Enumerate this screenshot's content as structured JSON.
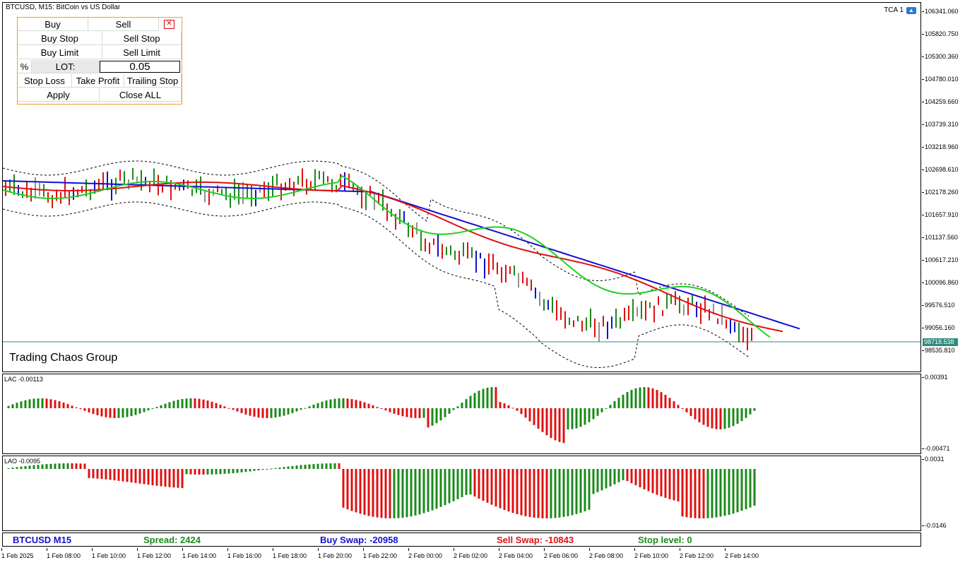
{
  "chart": {
    "title": "BTCUSD, M15:  BitCoin vs US Dollar",
    "tca_label": "TCA 1",
    "group_label": "Trading Chaos Group",
    "current_price": "98718.538",
    "price_ticks": [
      "106341.060",
      "105820.750",
      "105300.360",
      "104780.010",
      "104259.660",
      "103739.310",
      "103218.960",
      "102698.610",
      "102178.260",
      "101657.910",
      "101137.560",
      "100617.210",
      "100096.860",
      "99576.510",
      "99056.160",
      "98535.810"
    ],
    "colors": {
      "bull": "#1a8a1a",
      "bear": "#e01010",
      "neutral": "#909090",
      "blue_ma": "#1010d0",
      "red_ma": "#e01010",
      "green_ma": "#20d020",
      "bands": "#000000",
      "price_line": "#2e8b7a"
    }
  },
  "trade_panel": {
    "buy": "Buy",
    "sell": "Sell",
    "close_icon": "close-icon",
    "buy_stop": "Buy Stop",
    "sell_stop": "Sell Stop",
    "buy_limit": "Buy Limit",
    "sell_limit": "Sell Limit",
    "percent": "%",
    "lot_label": "LOT:",
    "lot_value": "0.05",
    "stop_loss": "Stop Loss",
    "take_profit": "Take Profit",
    "trailing_stop": "Trailing Stop",
    "apply": "Apply",
    "close_all": "Close ALL"
  },
  "lac": {
    "label": "LAC -0.00113",
    "axis_top": "0.00391",
    "axis_bottom": "-0.00471"
  },
  "lao": {
    "label": "LAO -0.0095",
    "axis_top": "0.0031",
    "axis_bottom": "-0.0146"
  },
  "status": {
    "symbol": "BTCUSD M15",
    "spread": "Spread: 2424",
    "buy_swap": "Buy Swap: -20958",
    "sell_swap": "Sell Swap: -10843",
    "stop_level": "Stop level: 0"
  },
  "time_axis": [
    "1 Feb 2025",
    "1 Feb 08:00",
    "1 Feb 10:00",
    "1 Feb 12:00",
    "1 Feb 14:00",
    "1 Feb 16:00",
    "1 Feb 18:00",
    "1 Feb 20:00",
    "1 Feb 22:00",
    "2 Feb 00:00",
    "2 Feb 02:00",
    "2 Feb 04:00",
    "2 Feb 06:00",
    "2 Feb 08:00",
    "2 Feb 10:00",
    "2 Feb 12:00",
    "2 Feb 14:00"
  ]
}
